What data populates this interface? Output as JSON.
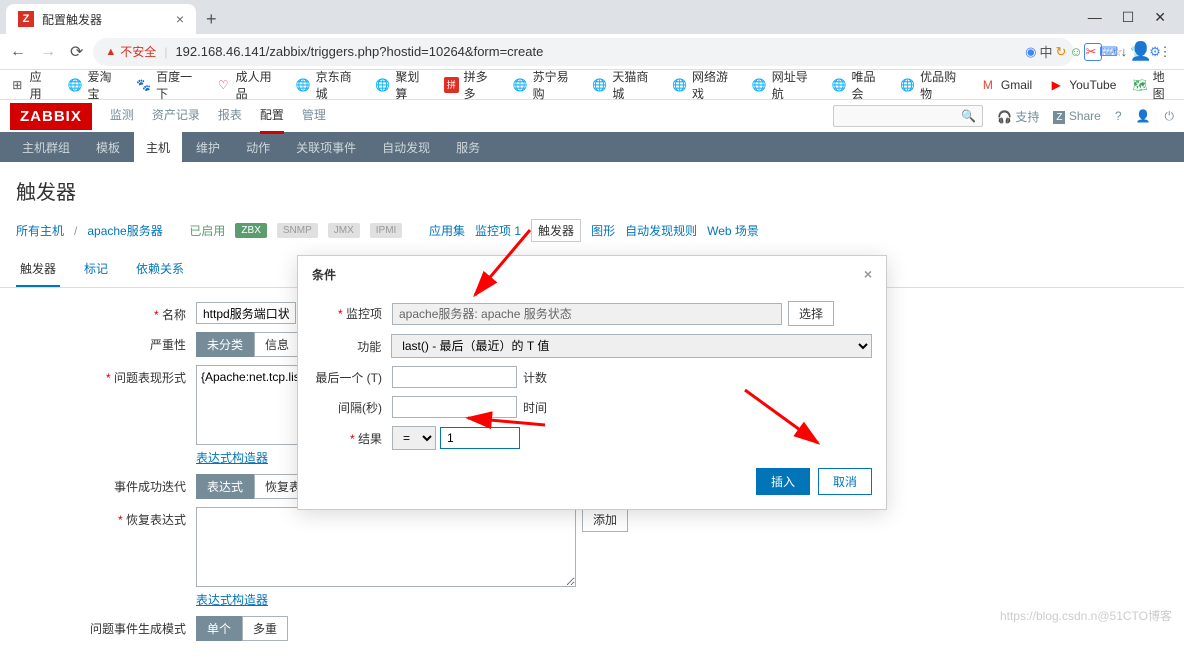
{
  "browser": {
    "tab_title": "配置触发器",
    "url_unsafe": "不安全",
    "url": "192.168.46.141/zabbix/triggers.php?hostid=10264&form=create"
  },
  "bookmarks": {
    "apps": "应用",
    "items": [
      "爱淘宝",
      "百度一下",
      "成人用品",
      "京东商城",
      "聚划算",
      "拼多多",
      "苏宁易购",
      "天猫商城",
      "网络游戏",
      "网址导航",
      "唯品会",
      "优品购物",
      "Gmail",
      "YouTube",
      "地图"
    ]
  },
  "zabbix": {
    "logo": "ZABBIX",
    "top_menu": [
      "监测",
      "资产记录",
      "报表",
      "配置",
      "管理"
    ],
    "top_active": 3,
    "support": "支持",
    "share": "Share",
    "sub_menu": [
      "主机群组",
      "模板",
      "主机",
      "维护",
      "动作",
      "关联项事件",
      "自动发现",
      "服务"
    ],
    "sub_active": 2
  },
  "page": {
    "title": "触发器",
    "breadcrumb": {
      "all_hosts": "所有主机",
      "host": "apache服务器",
      "enabled": "已启用",
      "zbx": "ZBX",
      "snmp": "SNMP",
      "jmx": "JMX",
      "ipmi": "IPMI",
      "app": "应用集",
      "items": "监控项 1",
      "triggers": "触发器",
      "graphs": "图形",
      "discovery": "自动发现规则",
      "web": "Web 场景"
    },
    "tabs": [
      "触发器",
      "标记",
      "依赖关系"
    ],
    "tabs_active": 0
  },
  "form": {
    "name_label": "名称",
    "name_value": "httpd服务端口状态",
    "severity_label": "严重性",
    "severity_opts": [
      "未分类",
      "信息"
    ],
    "expr_label": "问题表现形式",
    "expr_value": "{Apache:net.tcp.list",
    "add_btn": "添加",
    "builder": "表达式构造器",
    "ok_label": "事件成功迭代",
    "ok_opts": [
      "表达式",
      "恢复表"
    ],
    "recovery_label": "恢复表达式",
    "recovery_builder": "表达式构造器",
    "gen_label": "问题事件生成模式",
    "gen_opts": [
      "单个",
      "多重"
    ]
  },
  "modal": {
    "title": "条件",
    "item_label": "监控项",
    "item_value": "apache服务器: apache 服务状态",
    "select_btn": "选择",
    "func_label": "功能",
    "func_value": "last() - 最后（最近）的 T 值",
    "last_label": "最后一个 (T)",
    "count_label": "计数",
    "interval_label": "间隔(秒)",
    "time_label": "时间",
    "result_label": "结果",
    "result_op": "=",
    "result_value": "1",
    "insert_btn": "插入",
    "cancel_btn": "取消"
  },
  "watermark": "https://blog.csdn.n@51CTO博客"
}
